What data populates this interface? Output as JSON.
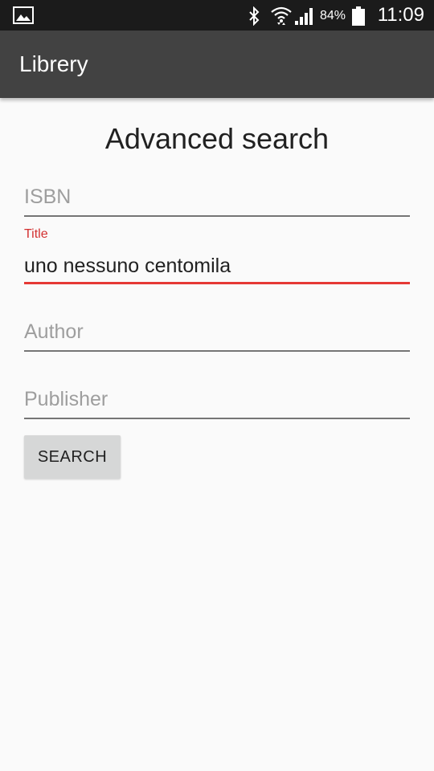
{
  "status_bar": {
    "icons": [
      "image-icon",
      "bluetooth-icon",
      "wifi-icon",
      "signal-icon",
      "battery-icon"
    ],
    "battery_percent": "84%",
    "time": "11:09"
  },
  "app_bar": {
    "title": "Librery",
    "background": "#424242"
  },
  "form": {
    "heading": "Advanced search",
    "fields": [
      {
        "name": "isbn",
        "placeholder": "ISBN",
        "value": "",
        "focused": false
      },
      {
        "name": "title",
        "label": "Title",
        "value": "uno nessuno centomila",
        "focused": true
      },
      {
        "name": "author",
        "placeholder": "Author",
        "value": "",
        "focused": false
      },
      {
        "name": "publisher",
        "placeholder": "Publisher",
        "value": "",
        "focused": false
      }
    ],
    "search_label": "SEARCH"
  },
  "colors": {
    "accent": "#e53935",
    "status_bar": "#1b1b1b",
    "button": "#d6d7d7",
    "background": "#fafafa"
  }
}
